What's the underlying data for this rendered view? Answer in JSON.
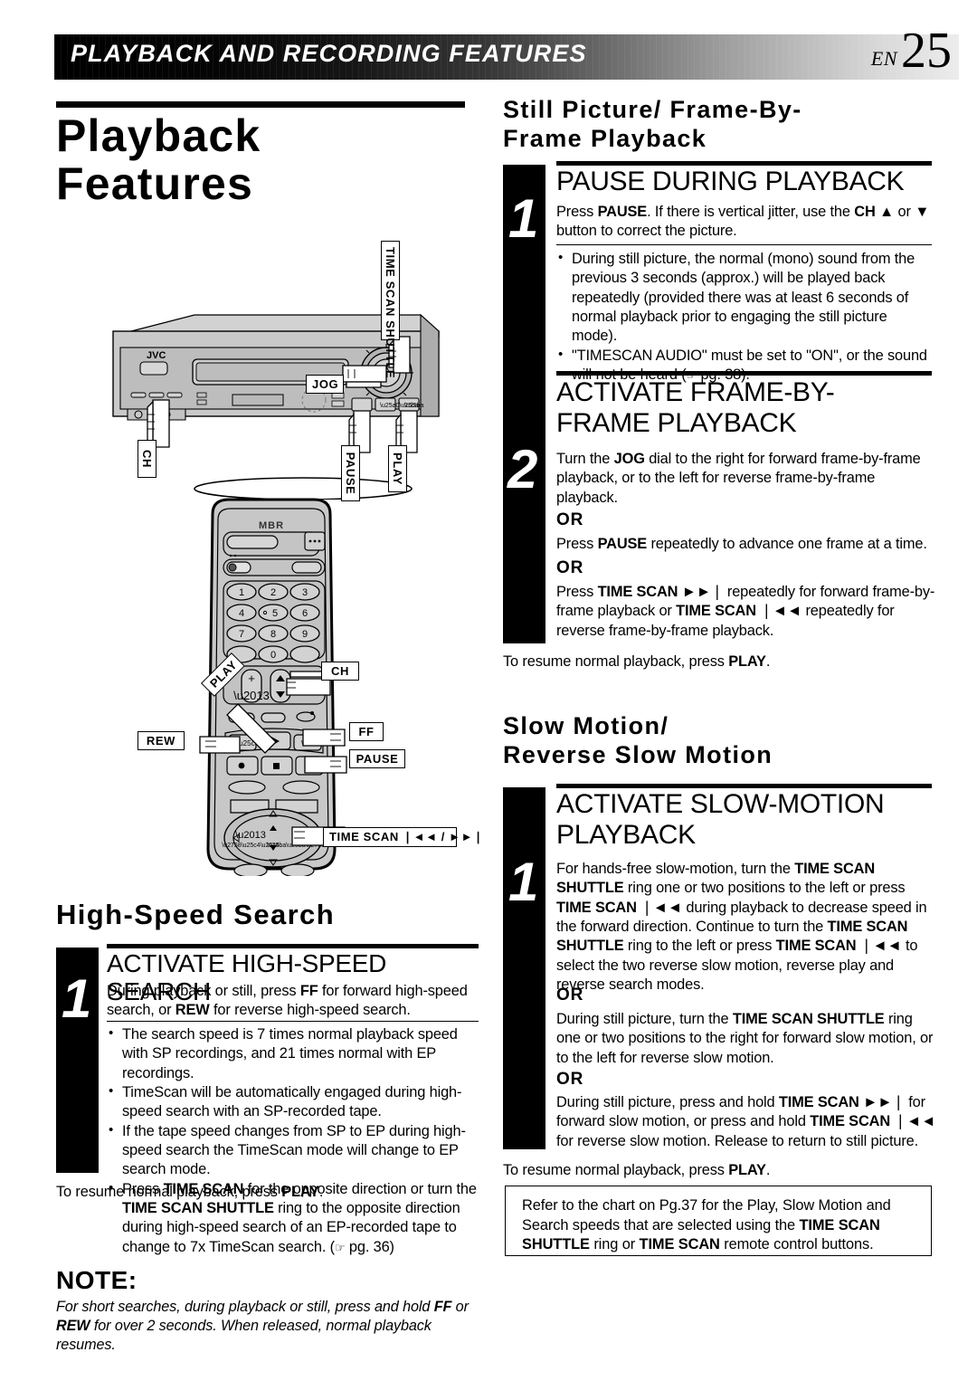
{
  "header": {
    "title": "PLAYBACK AND RECORDING FEATURES",
    "lang": "EN",
    "page": "25"
  },
  "left_column": {
    "page_title": "Playback\nFeatures",
    "illustration_vcr": {
      "brand": "JVC",
      "callouts": [
        {
          "name": "time-scan-shuttle",
          "label": "TIME SCAN SHUTTLE"
        },
        {
          "name": "jog",
          "label": "JOG"
        },
        {
          "name": "ch",
          "label": "CH"
        },
        {
          "name": "pause",
          "label": "PAUSE"
        },
        {
          "name": "play",
          "label": "PLAY"
        }
      ]
    },
    "illustration_remote": {
      "brand": "MBR",
      "keys": [
        "1",
        "2",
        "3",
        "4",
        "5",
        "6",
        "7",
        "8",
        "9",
        "0"
      ],
      "ch_plus": "+",
      "ch_minus": "–",
      "callouts": [
        {
          "name": "ch",
          "label": "CH"
        },
        {
          "name": "play",
          "label": "PLAY"
        },
        {
          "name": "rew",
          "label": "REW"
        },
        {
          "name": "ff",
          "label": "FF"
        },
        {
          "name": "pause",
          "label": "PAUSE"
        },
        {
          "name": "time-scan",
          "label": "TIME SCAN ❘◄◄ / ►►❘"
        }
      ]
    },
    "section": {
      "title": "High-Speed Search",
      "step": {
        "number": "1",
        "heading": "ACTIVATE HIGH-SPEED SEARCH",
        "intro_html": "During playback or still, press <b>FF</b> for forward high-speed search, or <b>REW</b> for reverse high-speed search.",
        "bullets_html": [
          "The search speed is 7 times normal playback speed with SP recordings, and 21 times normal with EP recordings.",
          "TimeScan will be automatically engaged during high-speed search with an SP-recorded tape.",
          "If the tape speed changes from SP to EP during high-speed search the TimeScan mode will change to EP search mode.",
          "Press <b>TIME SCAN</b> for the opposite direction or turn the <b>TIME SCAN SHUTTLE</b> ring to the opposite direction during high-speed search of an EP-recorded tape to change to 7x TimeScan search. (<span class=\"hand-glyph\">☞</span> pg. 36)"
        ]
      },
      "resume_html": "To resume normal playback, press <b>PLAY</b>."
    },
    "note": {
      "heading": "NOTE:",
      "body_html": "For short searches, during playback or still, press and hold <b>FF</b> or <b>REW</b> for over 2 seconds. When released, normal playback resumes."
    }
  },
  "right_column": {
    "section1": {
      "title": "Still Picture/ Frame-By-\nFrame Playback",
      "steps": [
        {
          "number": "1",
          "heading": "PAUSE DURING PLAYBACK",
          "intro_html": "Press <b>PAUSE</b>. If there is vertical jitter, use the <b>CH</b> ▲ or ▼ button to correct the picture.",
          "bullets_html": [
            "During still picture, the normal (mono) sound from the previous 3 seconds (approx.) will be played back repeatedly (provided there was at least 6 seconds of normal playback prior to engaging the still picture mode).",
            "\"TIMESCAN AUDIO\" must be set to \"ON\", or the sound will not be heard (<span class=\"hand-glyph\">☞</span> pg. 38)."
          ]
        },
        {
          "number": "2",
          "heading": "ACTIVATE FRAME-BY-\nFRAME PLAYBACK",
          "intro_html": "Turn the <b>JOG</b> dial to the right for forward frame-by-frame playback, or to the left for reverse frame-by-frame playback.",
          "or_label_1": "OR",
          "alt1_html": "Press <b>PAUSE</b> repeatedly to advance one frame at a time.",
          "or_label_2": "OR",
          "alt2_html": "Press <b>TIME SCAN</b> ►►❘ repeatedly for forward frame-by-frame playback or <b>TIME SCAN</b> ❘◄◄ repeatedly for reverse frame-by-frame playback."
        }
      ],
      "resume_html": "To resume normal playback, press <b>PLAY</b>."
    },
    "section2": {
      "title": "Slow Motion/\nReverse Slow Motion",
      "step": {
        "number": "1",
        "heading": "ACTIVATE SLOW-MOTION\nPLAYBACK",
        "intro_html": "For hands-free slow-motion, turn the <b>TIME SCAN SHUTTLE</b> ring one or two positions to the left or press <b>TIME SCAN</b> ❘◄◄ during playback to decrease speed in the forward direction. Continue to turn the <b>TIME SCAN SHUTTLE</b> ring to the left or press <b>TIME SCAN</b> ❘◄◄ to select the two reverse slow motion, reverse play and reverse search modes.",
        "or_label_1": "OR",
        "alt1_html": "During still picture, turn the <b>TIME SCAN SHUTTLE</b> ring one or two positions to the right for forward slow motion, or to the left for reverse slow motion.",
        "or_label_2": "OR",
        "alt2_html": "During still picture, press and hold <b>TIME SCAN</b> ►►❘ for forward slow motion, or press and hold <b>TIME SCAN</b> ❘◄◄ for reverse slow motion. Release to return to still picture."
      },
      "resume_html": "To resume normal playback, press <b>PLAY</b>.",
      "reference_box_html": "Refer to the chart on Pg.37 for the Play, Slow Motion and Search speeds that are selected using the <b>TIME SCAN SHUTTLE</b> ring or <b>TIME SCAN</b> remote control buttons."
    }
  },
  "colors": {
    "ink": "#000000",
    "paper": "#ffffff",
    "device_body": "#c9c9c9",
    "device_face": "#bfbfbf",
    "device_dark": "#9a9a9a"
  }
}
